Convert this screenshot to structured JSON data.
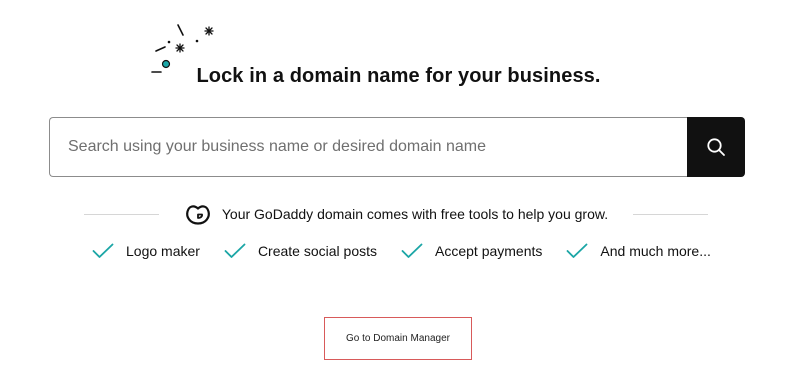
{
  "hero": {
    "sparkle_icon": "sparkle-decoration-icon",
    "headline": "Lock in a domain name for your business."
  },
  "search": {
    "placeholder": "Search using your business name or desired domain name",
    "button_icon": "search-icon"
  },
  "promo": {
    "logo_icon": "godaddy-logo-icon",
    "text": "Your GoDaddy domain comes with free tools to help you grow."
  },
  "features": [
    {
      "icon": "checkmark-icon",
      "label": "Logo maker"
    },
    {
      "icon": "checkmark-icon",
      "label": "Create social posts"
    },
    {
      "icon": "checkmark-icon",
      "label": "Accept payments"
    },
    {
      "icon": "checkmark-icon",
      "label": "And much more..."
    }
  ],
  "actions": {
    "domain_manager_label": "Go to Domain Manager"
  },
  "colors": {
    "accent_teal": "#1ba6a6",
    "search_button_bg": "#111111",
    "manager_border": "#d85a5a"
  }
}
